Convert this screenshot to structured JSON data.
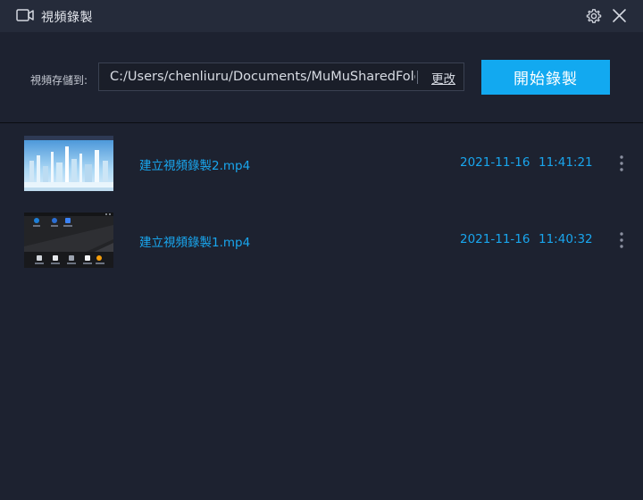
{
  "window": {
    "title": "視頻錄製",
    "icons": {
      "camera": "video-camera-icon",
      "settings": "gear-icon",
      "close": "close-icon"
    }
  },
  "storage": {
    "label": "視頻存儲到:",
    "path": "C:/Users/chenliuru/Documents/MuMuSharedFolder",
    "change_label": "更改"
  },
  "start_button": {
    "label": "開始錄製"
  },
  "colors": {
    "accent": "#12a9f0",
    "link": "#19a6ee",
    "background": "#1d2230",
    "titlebar": "#252b3a"
  },
  "recordings": [
    {
      "name": "建立視頻錄製2.mp4",
      "date": "2021-11-16",
      "time": "11:41:21",
      "thumbnail": "city-skyline"
    },
    {
      "name": "建立視頻錄製1.mp4",
      "date": "2021-11-16",
      "time": "11:40:32",
      "thumbnail": "android-desktop"
    }
  ]
}
